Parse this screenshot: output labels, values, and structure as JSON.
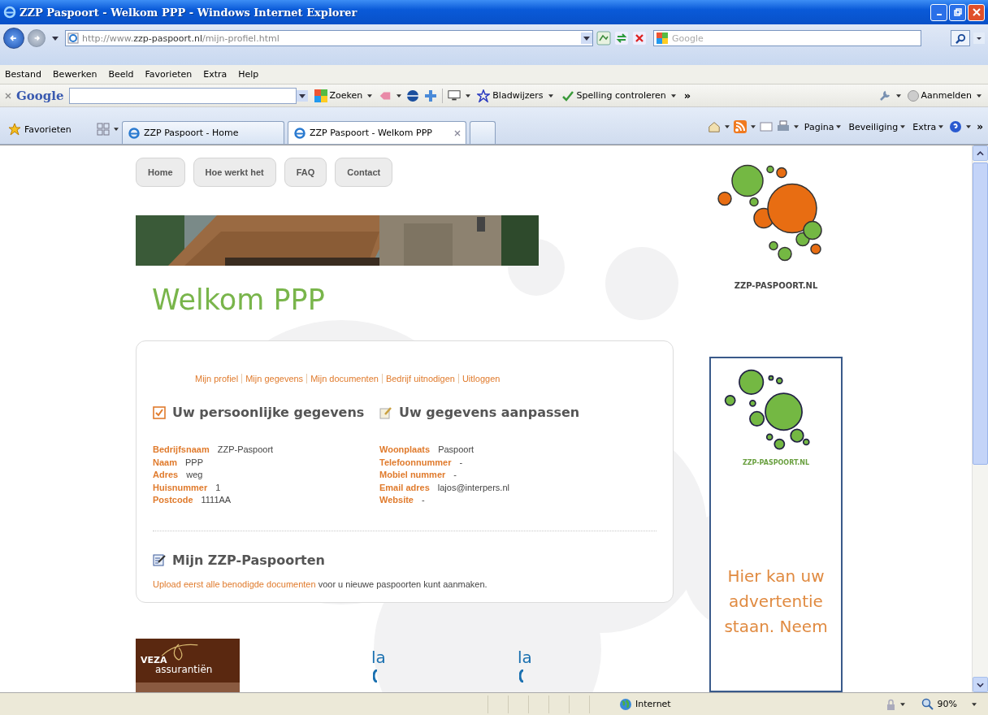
{
  "window": {
    "title": "ZZP Paspoort - Welkom PPP - Windows Internet Explorer"
  },
  "address_bar": {
    "url": "http://www.**zzp-paspoort.nl**/mijn-profiel.html",
    "search_placeholder": "Google"
  },
  "menu": [
    "Bestand",
    "Bewerken",
    "Beeld",
    "Favorieten",
    "Extra",
    "Help"
  ],
  "google_toolbar": {
    "brand": "Google",
    "items": [
      {
        "kind": "search",
        "label": "Zoeken"
      },
      {
        "kind": "bookmarks",
        "label": "Bladwijzers"
      },
      {
        "kind": "spelling",
        "label": "Spelling controleren"
      },
      {
        "kind": "more",
        "label": "»"
      }
    ],
    "sign_in": "Aanmelden"
  },
  "favorites_label": "Favorieten",
  "tabs": [
    {
      "label": "ZZP Paspoort - Home",
      "selected": false
    },
    {
      "label": "ZZP Paspoort - Welkom PPP",
      "selected": true
    }
  ],
  "command_bar": [
    "Pagina",
    "Beveiliging",
    "Extra"
  ],
  "command_more": "»",
  "page": {
    "nav": [
      "Home",
      "Hoe werkt het",
      "FAQ",
      "Contact"
    ],
    "heading": "Welkom PPP",
    "profile_links": [
      "Mijn profiel",
      "Mijn gegevens",
      "Mijn documenten",
      "Bedrijf uitnodigen",
      "Uitloggen"
    ],
    "personal_heading": "Uw persoonlijke gegevens",
    "edit_heading": "Uw gegevens aanpassen",
    "fields_left": [
      {
        "label": "Bedrijfsnaam",
        "value": "ZZP-Paspoort"
      },
      {
        "label": "Naam",
        "value": "PPP"
      },
      {
        "label": "Adres",
        "value": "weg"
      },
      {
        "label": "Huisnummer",
        "value": "1"
      },
      {
        "label": "Postcode",
        "value": "1111AA"
      }
    ],
    "fields_right": [
      {
        "label": "Woonplaats",
        "value": "Paspoort"
      },
      {
        "label": "Telefoonnummer",
        "value": "-"
      },
      {
        "label": "Mobiel nummer",
        "value": "-"
      },
      {
        "label": "Email adres",
        "value": "lajos@interpers.nl"
      },
      {
        "label": "Website",
        "value": "-"
      }
    ],
    "passports_heading": "Mijn ZZP-Paspoorten",
    "passports_link": "Upload eerst alle benodigde documenten",
    "passports_text": "voor u nieuwe paspoorten kunt aanmaken.",
    "sponsor": {
      "name": "VEZA",
      "subtitle": "assurantiën"
    },
    "partner_fragments": [
      "la",
      "la"
    ],
    "logo_text": "ZZP-PASPOORT.NL",
    "ad_logo_text": "ZZP-PASPOORT.NL",
    "ad_text": "Hier kan uw advertentie staan. Neem"
  },
  "status_bar": {
    "zone": "Internet",
    "zoom": "90%"
  }
}
